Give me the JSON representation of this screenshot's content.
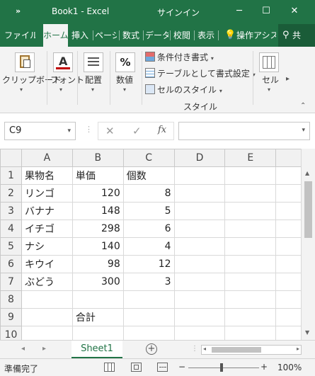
{
  "window": {
    "qat_label": "»",
    "title": "Book1  -  Excel",
    "signin": "サインイン",
    "minimize": "─",
    "maximize": "☐",
    "close": "✕"
  },
  "ribbon_tabs": [
    "ファイル",
    "ホーム",
    "挿入",
    "ページ",
    "数式",
    "データ",
    "校閲",
    "表示",
    "操作アシス",
    "共"
  ],
  "ribbon": {
    "clipboard": "クリップボード",
    "font": "フォント",
    "font_icon_letter": "A",
    "alignment": "配置",
    "number": "数値",
    "number_icon": "%",
    "styles_items": [
      "条件付き書式",
      "テーブルとして書式設定",
      "セルのスタイル"
    ],
    "styles_group": "スタイル",
    "cells": "セル"
  },
  "formula_bar": {
    "name_box": "C9",
    "cancel": "✕",
    "enter": "✓",
    "fx": "fx",
    "formula": ""
  },
  "grid": {
    "columns": [
      "A",
      "B",
      "C",
      "D",
      "E"
    ],
    "rows": [
      {
        "n": "1",
        "cells": [
          "果物名",
          "単価",
          "個数",
          "",
          ""
        ]
      },
      {
        "n": "2",
        "cells": [
          "リンゴ",
          "120",
          "8",
          "",
          ""
        ]
      },
      {
        "n": "3",
        "cells": [
          "バナナ",
          "148",
          "5",
          "",
          ""
        ]
      },
      {
        "n": "4",
        "cells": [
          "イチゴ",
          "298",
          "6",
          "",
          ""
        ]
      },
      {
        "n": "5",
        "cells": [
          "ナシ",
          "140",
          "4",
          "",
          ""
        ]
      },
      {
        "n": "6",
        "cells": [
          "キウイ",
          "98",
          "12",
          "",
          ""
        ]
      },
      {
        "n": "7",
        "cells": [
          "ぶどう",
          "300",
          "3",
          "",
          ""
        ]
      },
      {
        "n": "8",
        "cells": [
          "",
          "",
          "",
          "",
          ""
        ]
      },
      {
        "n": "9",
        "cells": [
          "",
          "合計",
          "",
          "",
          ""
        ]
      },
      {
        "n": "10",
        "cells": [
          "",
          "",
          "",
          "",
          ""
        ]
      }
    ]
  },
  "sheet_tabs": {
    "active": "Sheet1",
    "add": "+"
  },
  "status": {
    "ready": "準備完了",
    "zoom_minus": "−",
    "zoom_plus": "+",
    "zoom": "100%"
  },
  "colors": {
    "accent": "#217346"
  }
}
